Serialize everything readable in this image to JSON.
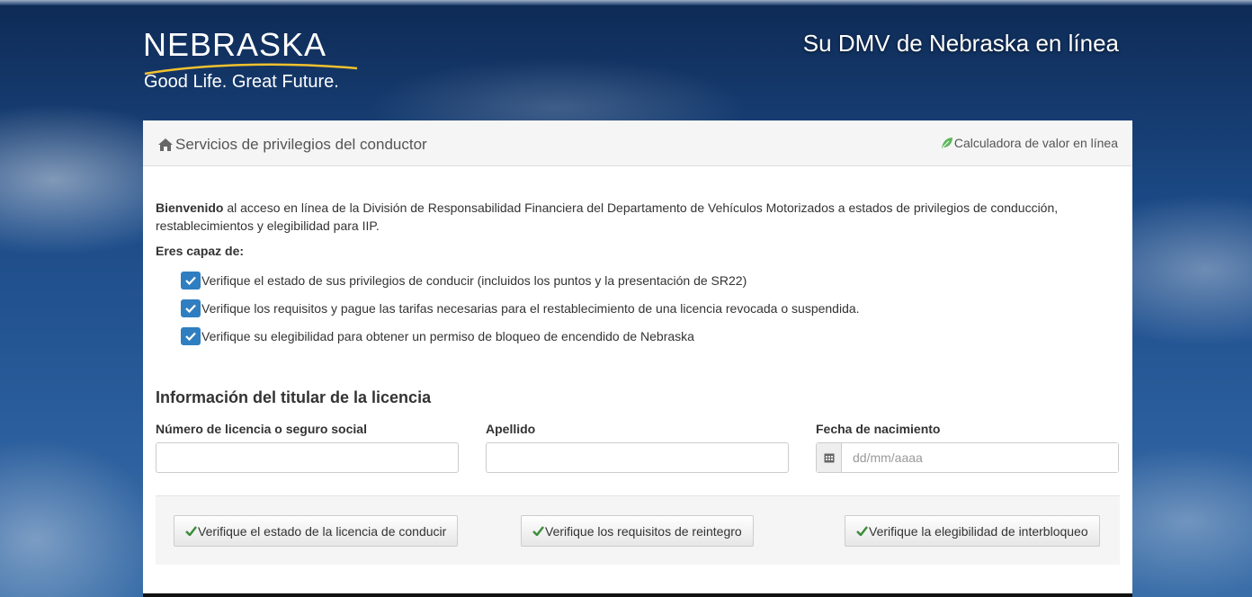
{
  "header": {
    "logo_word": "NEBRASKA",
    "logo_tagline": "Good Life. Great Future.",
    "site_title": "Su DMV de Nebraska en línea"
  },
  "panel": {
    "title": "Servicios de privilegios del conductor",
    "title_icon": "home-icon",
    "link_label": "Calculadora de valor en línea",
    "link_icon": "leaf-icon"
  },
  "intro": {
    "bold": "Bienvenido",
    "text": " al acceso en línea de la División de Responsabilidad Financiera del Departamento de Vehículos Motorizados a estados de privilegios de conducción, restablecimientos y elegibilidad para IIP.",
    "can_label": "Eres capaz de:",
    "items": [
      "Verifique el estado de sus privilegios de conducir (incluidos los puntos y la presentación de SR22)",
      "Verifique los requisitos y pague las tarifas necesarias para el restablecimiento de una licencia revocada o suspendida.",
      "Verifique su elegibilidad para obtener un permiso de bloqueo de encendido de Nebraska"
    ]
  },
  "form": {
    "heading": "Información del titular de la licencia",
    "license_label": "Número de licencia o seguro social",
    "license_value": "",
    "lastname_label": "Apellido",
    "lastname_value": "",
    "dob_label": "Fecha de nacimiento",
    "dob_placeholder": "dd/mm/aaaa",
    "dob_icon": "calendar-icon"
  },
  "actions": {
    "verify_license": "Verifique el estado de la licencia de conducir",
    "verify_reinstatement": "Verifique los requisitos de reintegro",
    "verify_interlock": "Verifique la elegibilidad de interbloqueo"
  },
  "colors": {
    "check_blue": "#2f7ec1",
    "check_green": "#3c8d3c",
    "leaf_green": "#5cb85c"
  }
}
